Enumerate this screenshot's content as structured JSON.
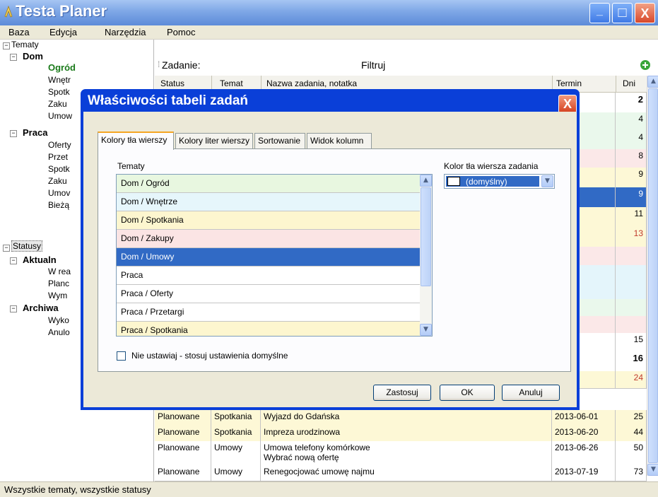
{
  "app": {
    "title": "Testa Planer"
  },
  "window_buttons": {
    "minimize": "_",
    "maximize": "□",
    "close": "X"
  },
  "menu": [
    "Baza",
    "Edycja",
    "Narzędzia",
    "Pomoc"
  ],
  "filter": {
    "label": "Zadanie:",
    "filter_label": "Filtruj"
  },
  "columns": {
    "status": "Status",
    "temat": "Temat",
    "nazwa": "Nazwa zadania, notatka",
    "termin": "Termin",
    "dni": "Dni"
  },
  "tree": {
    "root1": "Tematy",
    "dom": "Dom",
    "dom_children": [
      "Ogród",
      "Wnętr",
      "Spotk",
      "Zaku",
      "Umow"
    ],
    "praca": "Praca",
    "praca_children": [
      "Oferty",
      "Przet",
      "Spotk",
      "Zaku",
      "Umov",
      "Bieżą"
    ],
    "root2": "Statusy",
    "aktualne": "Aktualn",
    "aktualne_children": [
      "W rea",
      "Planc",
      "Wym"
    ],
    "archiwalne": "Archiwa",
    "archiwalne_children": [
      "Wyko",
      "Anulo"
    ]
  },
  "grid_rows_right": [
    {
      "termin": "5-09",
      "dni": "2",
      "bold": true
    },
    {
      "termin": "-11",
      "dni": "4"
    },
    {
      "termin": "-11",
      "dni": "4"
    },
    {
      "termin": "-15",
      "dni": "8"
    },
    {
      "termin": "-16",
      "dni": "9"
    },
    {
      "termin": "-16",
      "dni": "9",
      "selected": true
    },
    {
      "termin": "-18",
      "dni": "11"
    },
    {
      "termin": "-20",
      "dni": "13",
      "red": true
    },
    {
      "termin": "",
      "dni": ""
    },
    {
      "termin": "",
      "dni": ""
    },
    {
      "termin": "",
      "dni": ""
    },
    {
      "termin": "",
      "dni": ""
    },
    {
      "termin": "",
      "dni": ""
    },
    {
      "termin": "-22",
      "dni": "15"
    },
    {
      "termin": "5-23",
      "dni": "16",
      "bold": true
    },
    {
      "termin": "-31",
      "dni": "24",
      "red": true
    }
  ],
  "grid_rows_full": [
    {
      "status": "Planowane",
      "temat": "Spotkania",
      "nazwa": "Wyjazd do Gdańska",
      "termin": "2013-06-01",
      "dni": "25"
    },
    {
      "status": "Planowane",
      "temat": "Spotkania",
      "nazwa": "Impreza urodzinowa",
      "termin": "2013-06-20",
      "dni": "44"
    },
    {
      "status": "Planowane",
      "temat": "Umowy",
      "nazwa": "Umowa telefony komórkowe",
      "nazwa2": "Wybrać nową ofertę",
      "termin": "2013-06-26",
      "dni": "50"
    },
    {
      "status": "Planowane",
      "temat": "Umowy",
      "nazwa": "Renegocjować umowę najmu",
      "termin": "2013-07-19",
      "dni": "73"
    }
  ],
  "statusbar": "Wszystkie tematy, wszystkie statusy",
  "dialog": {
    "title": "Właściwości tabeli zadań",
    "close": "X",
    "tabs": [
      "Kolory tła wierszy",
      "Kolory liter wierszy",
      "Sortowanie",
      "Widok kolumn"
    ],
    "topics_label": "Tematy",
    "color_label": "Kolor tła wiersza zadania",
    "combo_value": "(domyślny)",
    "topics": [
      {
        "label": "Dom / Ogród",
        "bg": "#e8f7e0"
      },
      {
        "label": "Dom / Wnętrze",
        "bg": "#e6f6fb"
      },
      {
        "label": "Dom / Spotkania",
        "bg": "#fdf6cf"
      },
      {
        "label": "Dom / Zakupy",
        "bg": "#fbe4e4"
      },
      {
        "label": "Dom / Umowy",
        "bg": "#316ac5",
        "selected": true
      },
      {
        "label": "Praca",
        "bg": "#ffffff"
      },
      {
        "label": "Praca / Oferty",
        "bg": "#ffffff"
      },
      {
        "label": "Praca / Przetargi",
        "bg": "#ffffff"
      },
      {
        "label": "Praca / Spotkania",
        "bg": "#fdf6cf"
      }
    ],
    "checkbox_label": "Nie ustawiaj - stosuj ustawienia domyślne",
    "buttons": {
      "apply": "Zastosuj",
      "ok": "OK",
      "cancel": "Anuluj"
    }
  },
  "colors": {
    "accent": "#316ac5",
    "dialog_frame": "#0a3fd8",
    "add_icon": "#3aa53a"
  }
}
